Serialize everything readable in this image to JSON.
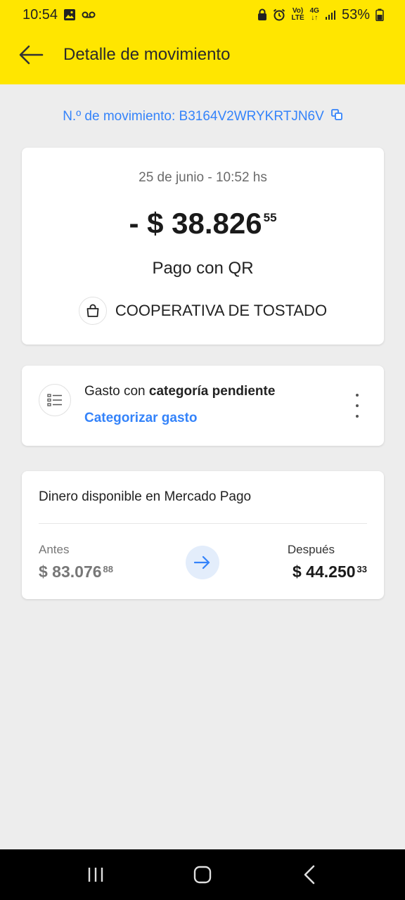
{
  "status_bar": {
    "time": "10:54",
    "battery": "53%",
    "network_top": "Vo)",
    "network_bottom": "LTE",
    "network_gen": "4G"
  },
  "header": {
    "title": "Detalle de movimiento",
    "background_color": "#ffe600"
  },
  "movement": {
    "id_label": "N.º de movimiento: B3164V2WRYKRTJN6V",
    "date": "25 de junio - 10:52 hs",
    "amount_main": "- $ 38.826",
    "amount_cents": "55",
    "payment_type": "Pago con QR",
    "merchant": "COOPERATIVA DE TOSTADO"
  },
  "category": {
    "text_prefix": "Gasto con",
    "text_bold": "categoría pendiente",
    "link": "Categorizar gasto"
  },
  "balance": {
    "title": "Dinero disponible en Mercado Pago",
    "before_label": "Antes",
    "before_value": "$ 83.076",
    "before_cents": "88",
    "after_label": "Después",
    "after_value": "$ 44.250",
    "after_cents": "33"
  },
  "colors": {
    "accent": "#3483fa",
    "brand_yellow": "#ffe600",
    "background": "#ededed"
  },
  "icons": [
    "back-arrow-icon",
    "copy-icon",
    "shopping-bag-icon",
    "list-icon",
    "more-vert-icon",
    "arrow-right-icon"
  ]
}
